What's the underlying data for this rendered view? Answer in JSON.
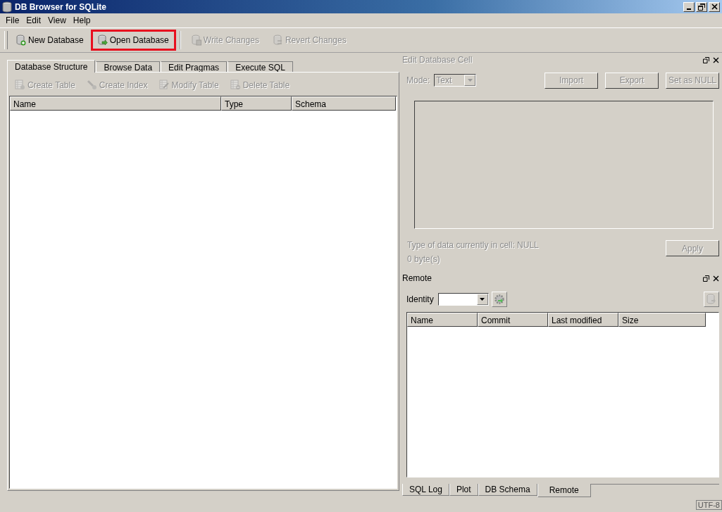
{
  "window": {
    "title": "DB Browser for SQLite"
  },
  "menu": [
    "File",
    "Edit",
    "View",
    "Help"
  ],
  "toolbar": [
    {
      "label": "New Database",
      "kind": "new",
      "disabled": false,
      "highlighted": false
    },
    {
      "label": "Open Database",
      "kind": "open",
      "disabled": false,
      "highlighted": true
    },
    {
      "label": "Write Changes",
      "kind": "write",
      "disabled": true,
      "highlighted": false
    },
    {
      "label": "Revert Changes",
      "kind": "revert",
      "disabled": true,
      "highlighted": false
    }
  ],
  "tabs": [
    {
      "label": "Database Structure",
      "selected": true
    },
    {
      "label": "Browse Data",
      "selected": false
    },
    {
      "label": "Edit Pragmas",
      "selected": false
    },
    {
      "label": "Execute SQL",
      "selected": false
    }
  ],
  "structure_toolbar": [
    {
      "label": "Create Table",
      "kind": "table",
      "disabled": true
    },
    {
      "label": "Create Index",
      "kind": "index",
      "disabled": true
    },
    {
      "label": "Modify Table",
      "kind": "modify",
      "disabled": true
    },
    {
      "label": "Delete Table",
      "kind": "delete",
      "disabled": true
    }
  ],
  "structure_table": {
    "columns": [
      "Name",
      "Type",
      "Schema"
    ]
  },
  "edit_cell": {
    "title": "Edit Database Cell",
    "mode_label": "Mode:",
    "mode_value": "Text",
    "mode_disabled": true,
    "buttons": [
      {
        "label": "Import",
        "disabled": true
      },
      {
        "label": "Export",
        "disabled": true
      },
      {
        "label": "Set as NULL",
        "disabled": true
      }
    ],
    "type_info": "Type of data currently in cell: NULL",
    "size_info": "0 byte(s)",
    "apply": {
      "label": "Apply",
      "disabled": true
    }
  },
  "remote": {
    "title": "Remote",
    "identity_label": "Identity",
    "columns": [
      "Name",
      "Commit",
      "Last modified",
      "Size"
    ]
  },
  "dock_tabs": [
    {
      "label": "SQL Log",
      "selected": false
    },
    {
      "label": "Plot",
      "selected": false
    },
    {
      "label": "DB Schema",
      "selected": false
    },
    {
      "label": "Remote",
      "selected": true
    }
  ],
  "status_bar": {
    "encoding": "UTF-8"
  }
}
